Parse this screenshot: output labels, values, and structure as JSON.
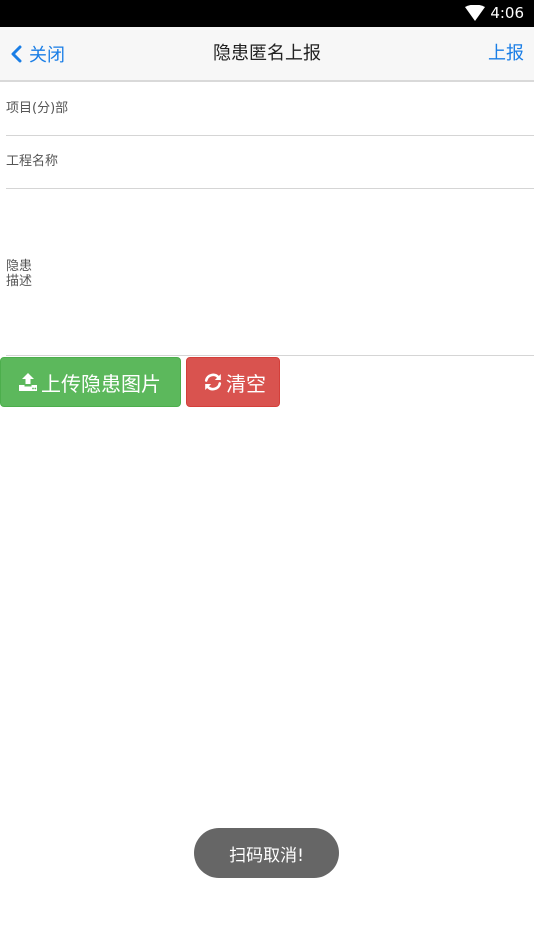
{
  "status_bar": {
    "time": "4:06",
    "wifi_icon": "wifi-icon"
  },
  "nav": {
    "back_label": "关闭",
    "title": "隐患匿名上报",
    "submit_label": "上报"
  },
  "form": {
    "project_label": "项目(分)部",
    "project_value": "",
    "project_name_label": "工程名称",
    "project_name_value": "",
    "description_label": "隐患描述",
    "description_value": ""
  },
  "buttons": {
    "upload_label": "上传隐患图片",
    "upload_icon": "upload-icon",
    "clear_label": "清空",
    "clear_icon": "refresh-icon"
  },
  "toast": {
    "message": "扫码取消!"
  },
  "colors": {
    "accent": "#1a7ee6",
    "upload_button": "#5cb85c",
    "clear_button": "#d9534f",
    "toast_background": "#666666"
  }
}
